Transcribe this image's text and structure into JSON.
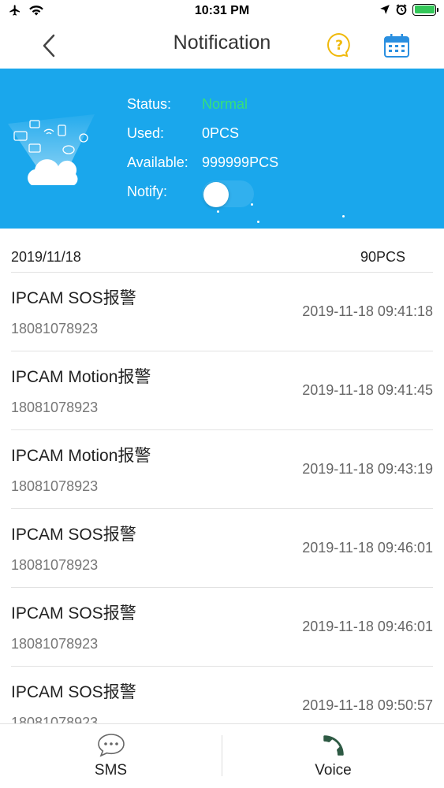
{
  "status_bar": {
    "time": "10:31 PM",
    "battery_color": "#34c759"
  },
  "nav": {
    "title": "Notification",
    "help_icon_glyph": "?"
  },
  "banner": {
    "background_color": "#1aa7ec",
    "status_label": "Status:",
    "status_value": "Normal",
    "status_value_color": "#35e07a",
    "used_label": "Used:",
    "used_value": "0PCS",
    "available_label": "Available:",
    "available_value": "999999PCS",
    "notify_label": "Notify:",
    "notify_enabled": false
  },
  "list": {
    "group_date": "2019/11/18",
    "group_count": "90PCS",
    "items": [
      {
        "title": "IPCAM SOS报警",
        "phone": "18081078923",
        "time": "2019-11-18 09:41:18"
      },
      {
        "title": "IPCAM Motion报警",
        "phone": "18081078923",
        "time": "2019-11-18 09:41:45"
      },
      {
        "title": "IPCAM Motion报警",
        "phone": "18081078923",
        "time": "2019-11-18 09:43:19"
      },
      {
        "title": "IPCAM SOS报警",
        "phone": "18081078923",
        "time": "2019-11-18 09:46:01"
      },
      {
        "title": "IPCAM SOS报警",
        "phone": "18081078923",
        "time": "2019-11-18 09:46:01"
      },
      {
        "title": "IPCAM SOS报警",
        "phone": "18081078923",
        "time": "2019-11-18 09:50:57"
      }
    ]
  },
  "tabs": {
    "sms_label": "SMS",
    "voice_label": "Voice",
    "sms_icon": "chat-bubble-icon",
    "voice_icon": "phone-icon"
  }
}
